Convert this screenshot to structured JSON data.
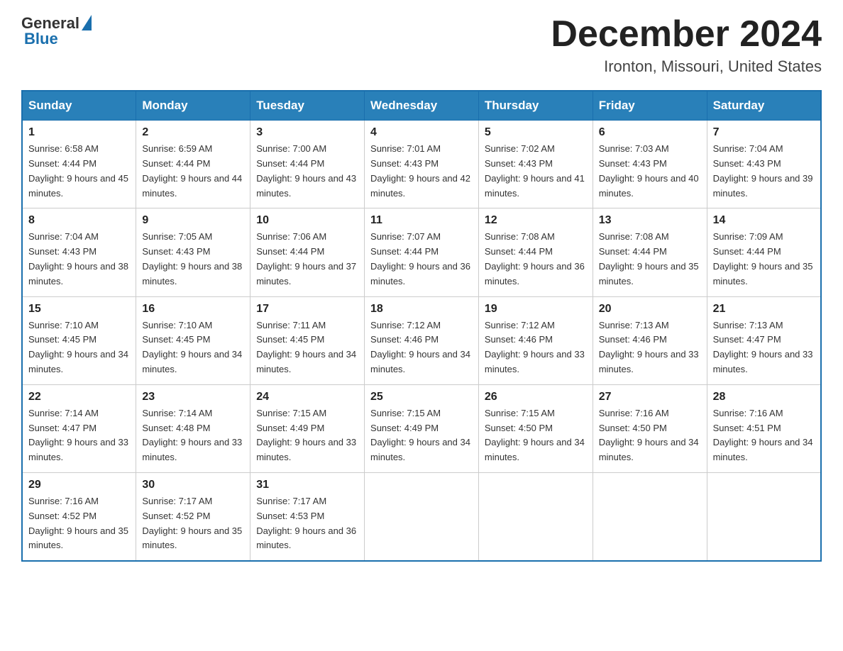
{
  "header": {
    "logo_general": "General",
    "logo_blue": "Blue",
    "month_year": "December 2024",
    "location": "Ironton, Missouri, United States"
  },
  "weekdays": [
    "Sunday",
    "Monday",
    "Tuesday",
    "Wednesday",
    "Thursday",
    "Friday",
    "Saturday"
  ],
  "weeks": [
    [
      {
        "day": "1",
        "sunrise": "6:58 AM",
        "sunset": "4:44 PM",
        "daylight": "9 hours and 45 minutes."
      },
      {
        "day": "2",
        "sunrise": "6:59 AM",
        "sunset": "4:44 PM",
        "daylight": "9 hours and 44 minutes."
      },
      {
        "day": "3",
        "sunrise": "7:00 AM",
        "sunset": "4:44 PM",
        "daylight": "9 hours and 43 minutes."
      },
      {
        "day": "4",
        "sunrise": "7:01 AM",
        "sunset": "4:43 PM",
        "daylight": "9 hours and 42 minutes."
      },
      {
        "day": "5",
        "sunrise": "7:02 AM",
        "sunset": "4:43 PM",
        "daylight": "9 hours and 41 minutes."
      },
      {
        "day": "6",
        "sunrise": "7:03 AM",
        "sunset": "4:43 PM",
        "daylight": "9 hours and 40 minutes."
      },
      {
        "day": "7",
        "sunrise": "7:04 AM",
        "sunset": "4:43 PM",
        "daylight": "9 hours and 39 minutes."
      }
    ],
    [
      {
        "day": "8",
        "sunrise": "7:04 AM",
        "sunset": "4:43 PM",
        "daylight": "9 hours and 38 minutes."
      },
      {
        "day": "9",
        "sunrise": "7:05 AM",
        "sunset": "4:43 PM",
        "daylight": "9 hours and 38 minutes."
      },
      {
        "day": "10",
        "sunrise": "7:06 AM",
        "sunset": "4:44 PM",
        "daylight": "9 hours and 37 minutes."
      },
      {
        "day": "11",
        "sunrise": "7:07 AM",
        "sunset": "4:44 PM",
        "daylight": "9 hours and 36 minutes."
      },
      {
        "day": "12",
        "sunrise": "7:08 AM",
        "sunset": "4:44 PM",
        "daylight": "9 hours and 36 minutes."
      },
      {
        "day": "13",
        "sunrise": "7:08 AM",
        "sunset": "4:44 PM",
        "daylight": "9 hours and 35 minutes."
      },
      {
        "day": "14",
        "sunrise": "7:09 AM",
        "sunset": "4:44 PM",
        "daylight": "9 hours and 35 minutes."
      }
    ],
    [
      {
        "day": "15",
        "sunrise": "7:10 AM",
        "sunset": "4:45 PM",
        "daylight": "9 hours and 34 minutes."
      },
      {
        "day": "16",
        "sunrise": "7:10 AM",
        "sunset": "4:45 PM",
        "daylight": "9 hours and 34 minutes."
      },
      {
        "day": "17",
        "sunrise": "7:11 AM",
        "sunset": "4:45 PM",
        "daylight": "9 hours and 34 minutes."
      },
      {
        "day": "18",
        "sunrise": "7:12 AM",
        "sunset": "4:46 PM",
        "daylight": "9 hours and 34 minutes."
      },
      {
        "day": "19",
        "sunrise": "7:12 AM",
        "sunset": "4:46 PM",
        "daylight": "9 hours and 33 minutes."
      },
      {
        "day": "20",
        "sunrise": "7:13 AM",
        "sunset": "4:46 PM",
        "daylight": "9 hours and 33 minutes."
      },
      {
        "day": "21",
        "sunrise": "7:13 AM",
        "sunset": "4:47 PM",
        "daylight": "9 hours and 33 minutes."
      }
    ],
    [
      {
        "day": "22",
        "sunrise": "7:14 AM",
        "sunset": "4:47 PM",
        "daylight": "9 hours and 33 minutes."
      },
      {
        "day": "23",
        "sunrise": "7:14 AM",
        "sunset": "4:48 PM",
        "daylight": "9 hours and 33 minutes."
      },
      {
        "day": "24",
        "sunrise": "7:15 AM",
        "sunset": "4:49 PM",
        "daylight": "9 hours and 33 minutes."
      },
      {
        "day": "25",
        "sunrise": "7:15 AM",
        "sunset": "4:49 PM",
        "daylight": "9 hours and 34 minutes."
      },
      {
        "day": "26",
        "sunrise": "7:15 AM",
        "sunset": "4:50 PM",
        "daylight": "9 hours and 34 minutes."
      },
      {
        "day": "27",
        "sunrise": "7:16 AM",
        "sunset": "4:50 PM",
        "daylight": "9 hours and 34 minutes."
      },
      {
        "day": "28",
        "sunrise": "7:16 AM",
        "sunset": "4:51 PM",
        "daylight": "9 hours and 34 minutes."
      }
    ],
    [
      {
        "day": "29",
        "sunrise": "7:16 AM",
        "sunset": "4:52 PM",
        "daylight": "9 hours and 35 minutes."
      },
      {
        "day": "30",
        "sunrise": "7:17 AM",
        "sunset": "4:52 PM",
        "daylight": "9 hours and 35 minutes."
      },
      {
        "day": "31",
        "sunrise": "7:17 AM",
        "sunset": "4:53 PM",
        "daylight": "9 hours and 36 minutes."
      },
      null,
      null,
      null,
      null
    ]
  ],
  "labels": {
    "sunrise": "Sunrise: ",
    "sunset": "Sunset: ",
    "daylight": "Daylight: "
  }
}
